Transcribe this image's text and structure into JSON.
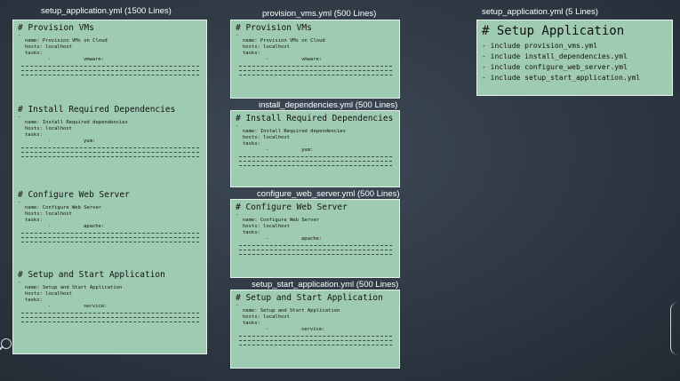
{
  "captions": {
    "main": "setup_application.yml (1500 Lines)",
    "provision": "provision_vms.yml (500 Lines)",
    "install": "install_dependencies.yml (500 Lines)",
    "configure": "configure_web_server.yml (500 Lines)",
    "start": "setup_start_application.yml (500 Lines)",
    "summary": "setup_application.yml (5 Lines)"
  },
  "sections": {
    "provision": {
      "heading": "# Provision VMs",
      "dash": "-",
      "name": "name: Provision VMs on Cloud",
      "hosts": "hosts: localhost",
      "tasks": "tasks:",
      "bullet": "-",
      "module": "vmware:"
    },
    "install": {
      "heading": "# Install Required Dependencies",
      "dash": "-",
      "name": "name: Install Required dependencies",
      "hosts": "hosts: localhost",
      "tasks": "tasks:",
      "bullet": "-",
      "module": "yum:"
    },
    "configure": {
      "heading": "# Configure Web Server",
      "dash": "-",
      "name": "name: Configure Web Server",
      "hosts": "hosts: localhost",
      "tasks": "tasks:",
      "bullet": "-",
      "module": "apache:"
    },
    "start": {
      "heading": "# Setup and Start Application",
      "dash": "-",
      "name": "name: Setup and Start Application",
      "hosts": "hosts: localhost",
      "tasks": "tasks:",
      "bullet": "-",
      "module": "service:"
    }
  },
  "summary": {
    "title": "# Setup Application",
    "includes": [
      "- include provision_vms.yml",
      "- include install_dependencies.yml",
      "- include configure_web_server.yml",
      "- include setup_start_application.yml"
    ]
  }
}
